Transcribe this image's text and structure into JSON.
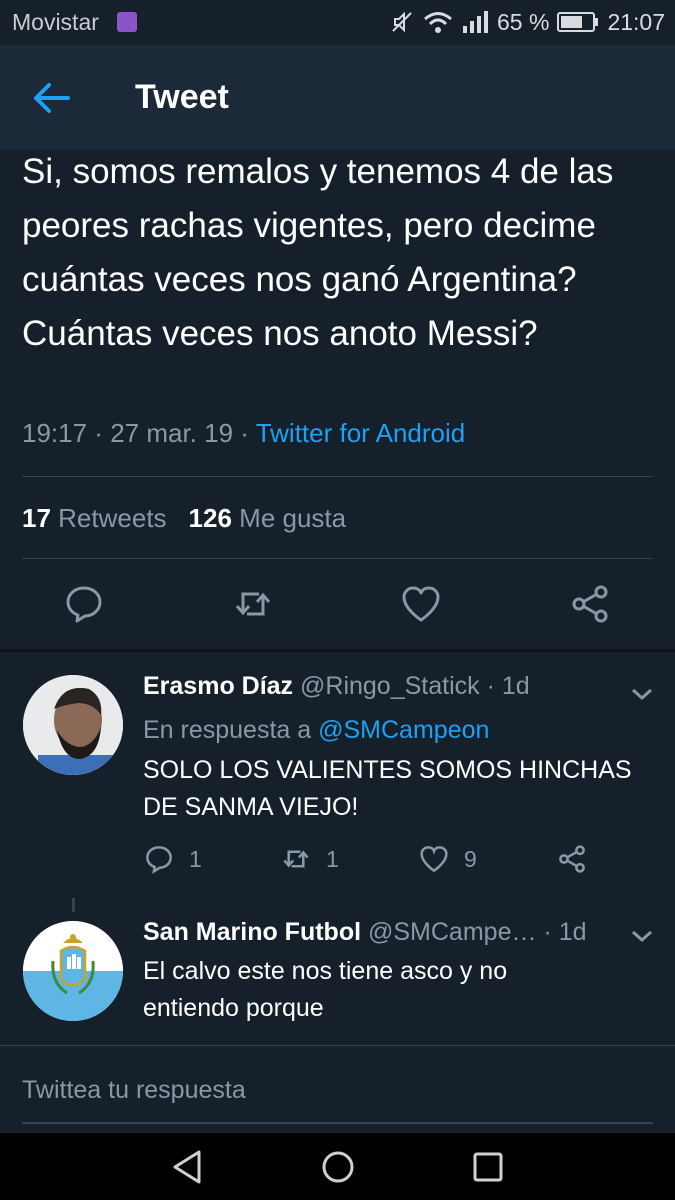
{
  "status_bar": {
    "carrier": "Movistar",
    "battery": "65 %",
    "time": "21:07"
  },
  "header": {
    "back_icon": "arrow-left-icon",
    "title": "Tweet",
    "accent_color": "#1da1f2"
  },
  "tweet": {
    "text": "Si, somos remalos y tenemos 4 de las peores rachas vigentes, pero decime cuántas veces nos ganó Argentina? Cuántas veces nos anoto Messi?",
    "time": "19:17",
    "date": "27 mar. 19",
    "source": "Twitter for Android",
    "retweets_count": "17",
    "retweets_label": "Retweets",
    "likes_count": "126",
    "likes_label": "Me gusta"
  },
  "replies": [
    {
      "name": "Erasmo Díaz",
      "handle": "@Ringo_Statick",
      "age": "1d",
      "in_reply_prefix": "En respuesta a",
      "in_reply_handle": "@SMCampeon",
      "text": "SOLO LOS VALIENTES SOMOS HINCHAS DE SANMA VIEJO!",
      "reply_count": "1",
      "retweet_count": "1",
      "like_count": "9"
    },
    {
      "name": "San Marino Futbol",
      "handle": "@SMCampe…",
      "age": "1d",
      "text": "El calvo este nos tiene asco y no entiendo porque"
    }
  ],
  "compose": {
    "placeholder": "Twittea tu respuesta"
  },
  "separator": " · "
}
